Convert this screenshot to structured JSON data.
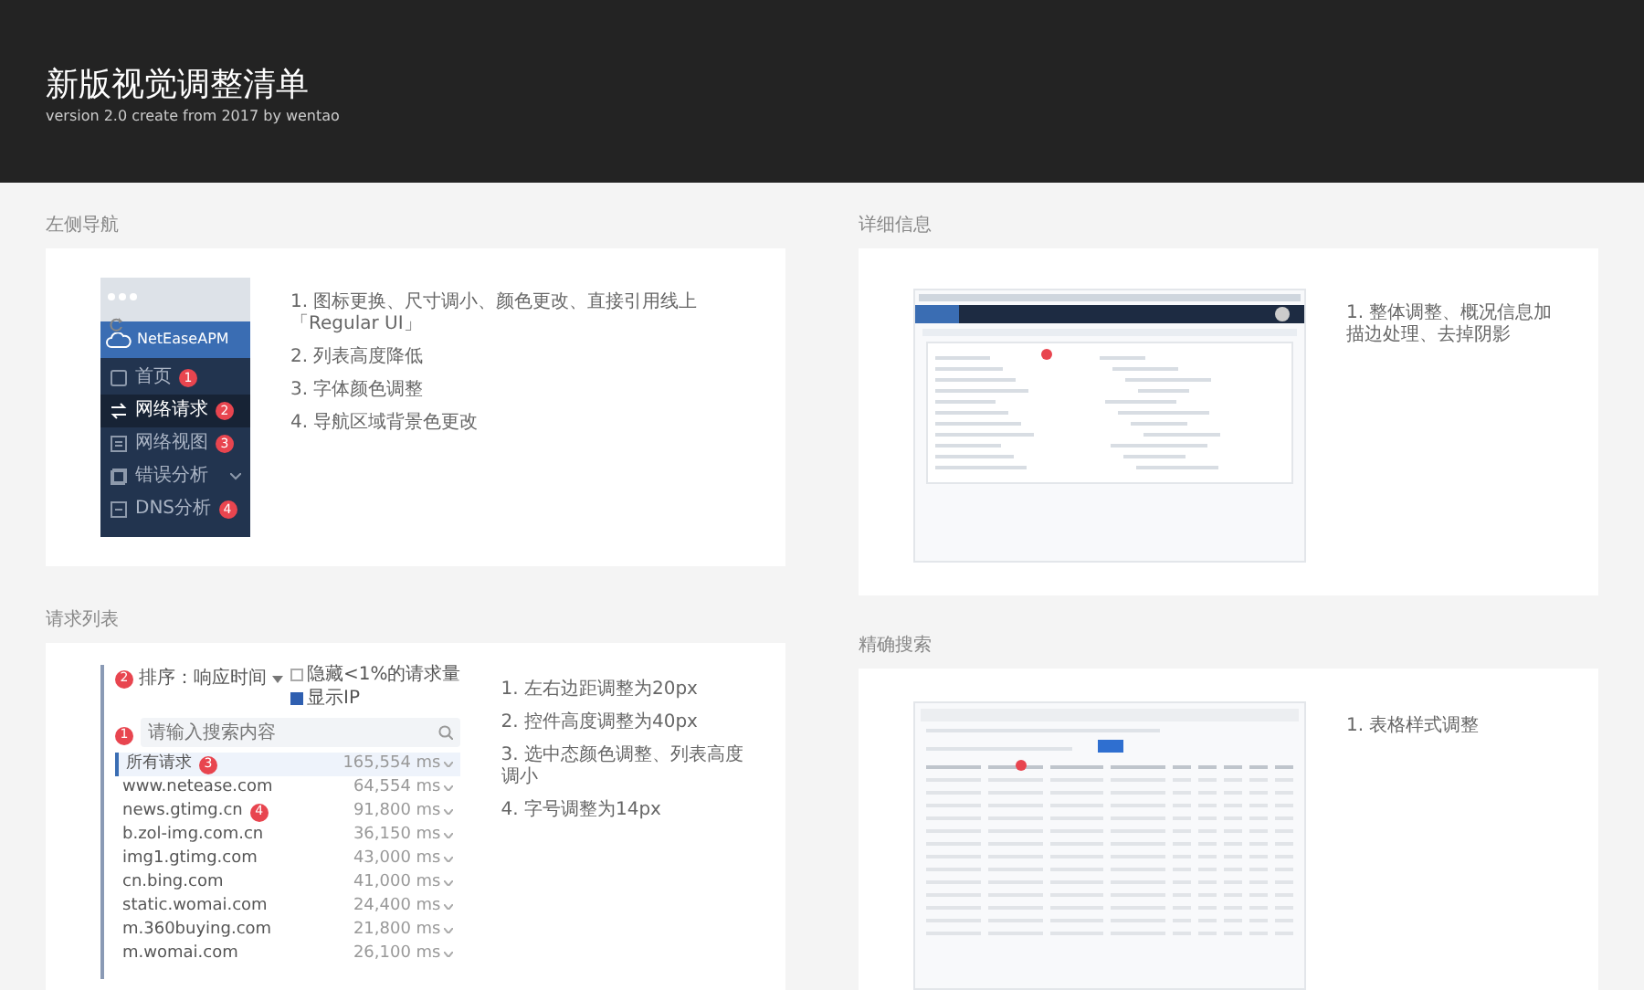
{
  "header": {
    "title": "新版视觉调整清单",
    "subtitle": "version 2.0  create from 2017  by wentao"
  },
  "left_column": [
    {
      "kind": "nav",
      "title": "左侧导航",
      "mockup": {
        "brand": "NetEaseAPM",
        "items": [
          {
            "label": "首页",
            "selected": false,
            "expandable": false,
            "badge": "1"
          },
          {
            "label": "网络请求",
            "selected": true,
            "expandable": false,
            "badge": "2"
          },
          {
            "label": "网络视图",
            "selected": false,
            "expandable": false,
            "badge": "3"
          },
          {
            "label": "错误分析",
            "selected": false,
            "expandable": true
          },
          {
            "label": "DNS分析",
            "selected": false,
            "expandable": false,
            "badge": "4"
          }
        ]
      },
      "notes": [
        "1. 图标更换、尺寸调小、颜色更改、直接引用线上「Regular UI」",
        "2. 列表高度降低",
        "3. 字体颜色调整",
        "4. 导航区域背景色更改"
      ]
    },
    {
      "kind": "requests",
      "title": "请求列表",
      "mockup": {
        "sort_label": "排序：响应时间",
        "sort_badge": "2",
        "options": [
          {
            "label": "隐藏<1%的请求量",
            "checked": false
          },
          {
            "label": "显示IP",
            "checked": true
          }
        ],
        "search": {
          "placeholder": "请输入搜索内容",
          "badge": "1"
        },
        "rows": [
          {
            "host": "所有请求",
            "value": "165,554 ms",
            "selected": true,
            "badge": "3"
          },
          {
            "host": "www.netease.com",
            "value": "64,554 ms",
            "selected": false
          },
          {
            "host": "news.gtimg.cn",
            "value": "91,800 ms",
            "selected": false,
            "badge": "4"
          },
          {
            "host": "b.zol-img.com.cn",
            "value": "36,150 ms",
            "selected": false
          },
          {
            "host": "img1.gtimg.com",
            "value": "43,000 ms",
            "selected": false
          },
          {
            "host": "cn.bing.com",
            "value": "41,000 ms",
            "selected": false
          },
          {
            "host": "static.womai.com",
            "value": "24,400 ms",
            "selected": false
          },
          {
            "host": "m.360buying.com",
            "value": "21,800 ms",
            "selected": false
          },
          {
            "host": "m.womai.com",
            "value": "26,100 ms",
            "selected": false
          }
        ]
      },
      "notes": [
        "1. 左右边距调整为20px",
        "2. 控件高度调整为40px",
        "3. 选中态颜色调整、列表高度调小",
        "4. 字号调整为14px"
      ]
    }
  ],
  "right_column": [
    {
      "kind": "detail",
      "title": "详细信息",
      "notes": [
        "1. 整体调整、概况信息加描边处理、去掉阴影"
      ]
    },
    {
      "kind": "search",
      "title": "精确搜索",
      "notes": [
        "1. 表格样式调整"
      ]
    }
  ]
}
